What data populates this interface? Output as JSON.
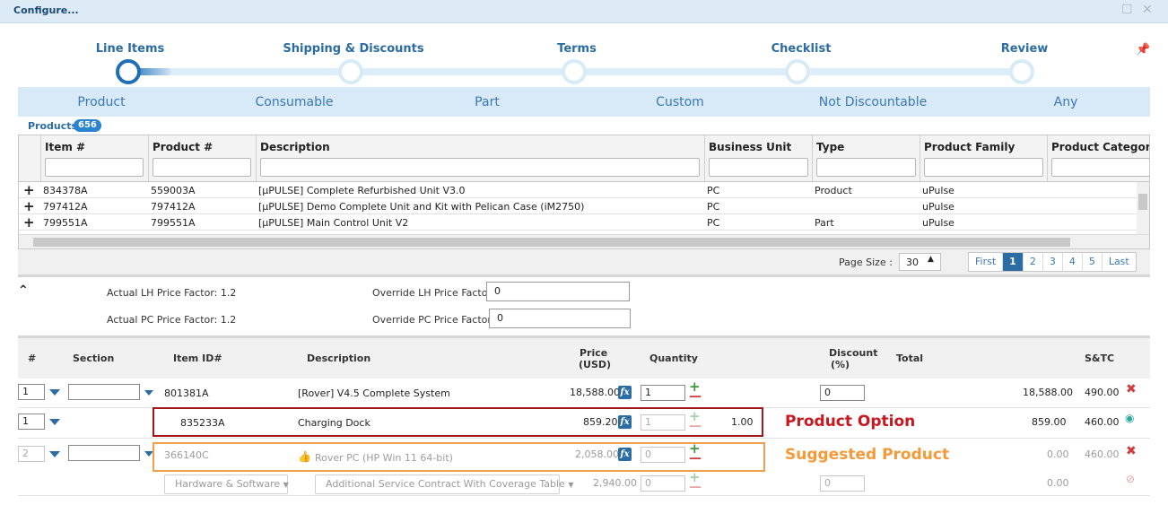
{
  "window": {
    "title": "Configure..."
  },
  "steps": [
    {
      "label": "Line Items",
      "active": true
    },
    {
      "label": "Shipping & Discounts",
      "active": false
    },
    {
      "label": "Terms",
      "active": false
    },
    {
      "label": "Checklist",
      "active": false
    },
    {
      "label": "Review",
      "active": false
    }
  ],
  "categories": [
    "Product",
    "Consumable",
    "Part",
    "Custom",
    "Not Discountable",
    "Any"
  ],
  "products": {
    "label": "Products",
    "count": "656",
    "columns": [
      "Item #",
      "Product #",
      "Description",
      "Business Unit",
      "Type",
      "Product Family",
      "Product Categor"
    ],
    "rows": [
      {
        "item": "834378A",
        "product": "559003A",
        "description": "[µPULSE] Complete Refurbished Unit V3.0",
        "bu": "PC",
        "type": "Product",
        "family": "uPulse",
        "category": ""
      },
      {
        "item": "797412A",
        "product": "797412A",
        "description": "[µPULSE] Demo Complete Unit and Kit with Pelican Case (iM2750)",
        "bu": "PC",
        "type": "",
        "family": "uPulse",
        "category": ""
      },
      {
        "item": "799551A",
        "product": "799551A",
        "description": "[µPULSE] Main Control Unit V2",
        "bu": "PC",
        "type": "Part",
        "family": "uPulse",
        "category": ""
      }
    ]
  },
  "pager": {
    "page_size_label": "Page Size :",
    "page_size": "30",
    "buttons": [
      "First",
      "1",
      "2",
      "3",
      "4",
      "5",
      "Last"
    ],
    "current": "1"
  },
  "price_factors": {
    "actual_lh": "Actual LH Price Factor: 1.2",
    "actual_pc": "Actual PC Price Factor: 1.2",
    "override_lh_label": "Override LH Price Factor:",
    "override_lh_value": "0",
    "override_pc_label": "Override PC Price Factor:",
    "override_pc_value": "0"
  },
  "line_items": {
    "headers": {
      "num": "#",
      "section": "Section",
      "item_id": "Item ID#",
      "description": "Description",
      "price1": "Price",
      "price2": "(USD)",
      "quantity": "Quantity",
      "discount1": "Discount",
      "discount2": "(%)",
      "total": "Total",
      "stc": "S&TC"
    },
    "rows": [
      {
        "num": "1",
        "item_id": "801381A",
        "description": "[Rover] V4.5 Complete System",
        "price": "18,588.00",
        "qty": "1",
        "discount": "0",
        "total": "18,588.00",
        "stc": "490.00"
      },
      {
        "num": "1",
        "item_id": "835233A",
        "description": "Charging Dock",
        "price": "859.20",
        "qty": "1",
        "qty_display": "1.00",
        "total": "859.00",
        "stc": "460.00"
      },
      {
        "num": "2",
        "item_id": "366140C",
        "description": "Rover PC (HP Win 11 64-bit)",
        "price": "2,058.00",
        "qty": "0",
        "total": "0.00",
        "stc": "460.00"
      },
      {
        "dd1": "Hardware & Software",
        "dd2": "Additional Service Contract With Coverage Table",
        "price": "2,940.00",
        "qty": "0",
        "discount": "0",
        "total": "0.00"
      }
    ]
  },
  "annotations": {
    "product_option": "Product Option",
    "suggested_product": "Suggested Product"
  },
  "icons": {
    "maximize": "maximize-icon",
    "close": "close-icon",
    "pin": "pin-icon",
    "expand": "plus-icon",
    "collapse": "chevron-up-icon",
    "formula": "fx-icon",
    "delete": "delete-icon",
    "view": "eye-icon",
    "hide": "eye-off-icon",
    "thumb": "thumbs-up-icon"
  },
  "colors": {
    "accent": "#2b6ca3",
    "band": "#d8eaf7",
    "titlebar": "#dcebf5",
    "option_box": "#a11818",
    "suggested_box": "#f0a04b"
  }
}
